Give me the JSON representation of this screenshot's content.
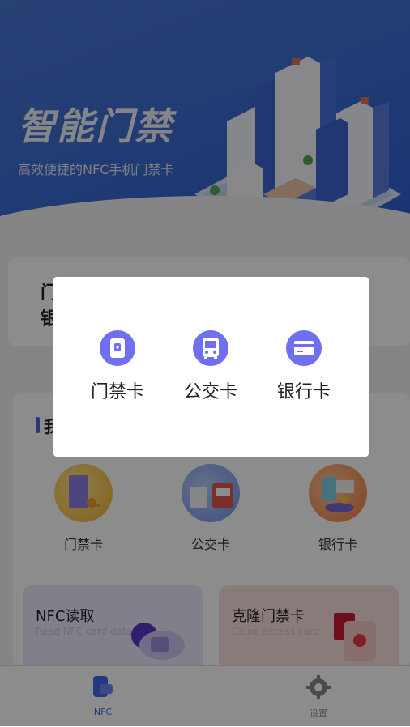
{
  "hero": {
    "title": "智能门禁",
    "subtitle": "高效便捷的NFC手机门禁卡"
  },
  "top_card": {
    "line1": "门",
    "line2": "银"
  },
  "panel": {
    "title": "我"
  },
  "categories": [
    {
      "label": "门禁卡",
      "icon": "door-card-icon"
    },
    {
      "label": "公交卡",
      "icon": "bus-card-icon"
    },
    {
      "label": "银行卡",
      "icon": "bank-card-icon"
    }
  ],
  "cards": [
    {
      "title": "NFC读取",
      "subtitle": "Read NFC card data",
      "icon": "cloud-nfc-icon"
    },
    {
      "title": "克隆门禁卡",
      "subtitle": "Clone access card",
      "icon": "nfc-card-icon"
    }
  ],
  "tabbar": [
    {
      "label": "NFC",
      "icon": "nfc-tab-icon",
      "active": true
    },
    {
      "label": "设置",
      "icon": "gear-icon",
      "active": false
    }
  ],
  "dialog": {
    "options": [
      {
        "label": "门禁卡",
        "icon": "nfc-door-icon"
      },
      {
        "label": "公交卡",
        "icon": "bus-icon"
      },
      {
        "label": "银行卡",
        "icon": "credit-card-icon"
      }
    ]
  },
  "colors": {
    "brand_blue": "#3a66d4",
    "accent_purple": "#6f6ff0",
    "active_tab": "#4468e6"
  }
}
